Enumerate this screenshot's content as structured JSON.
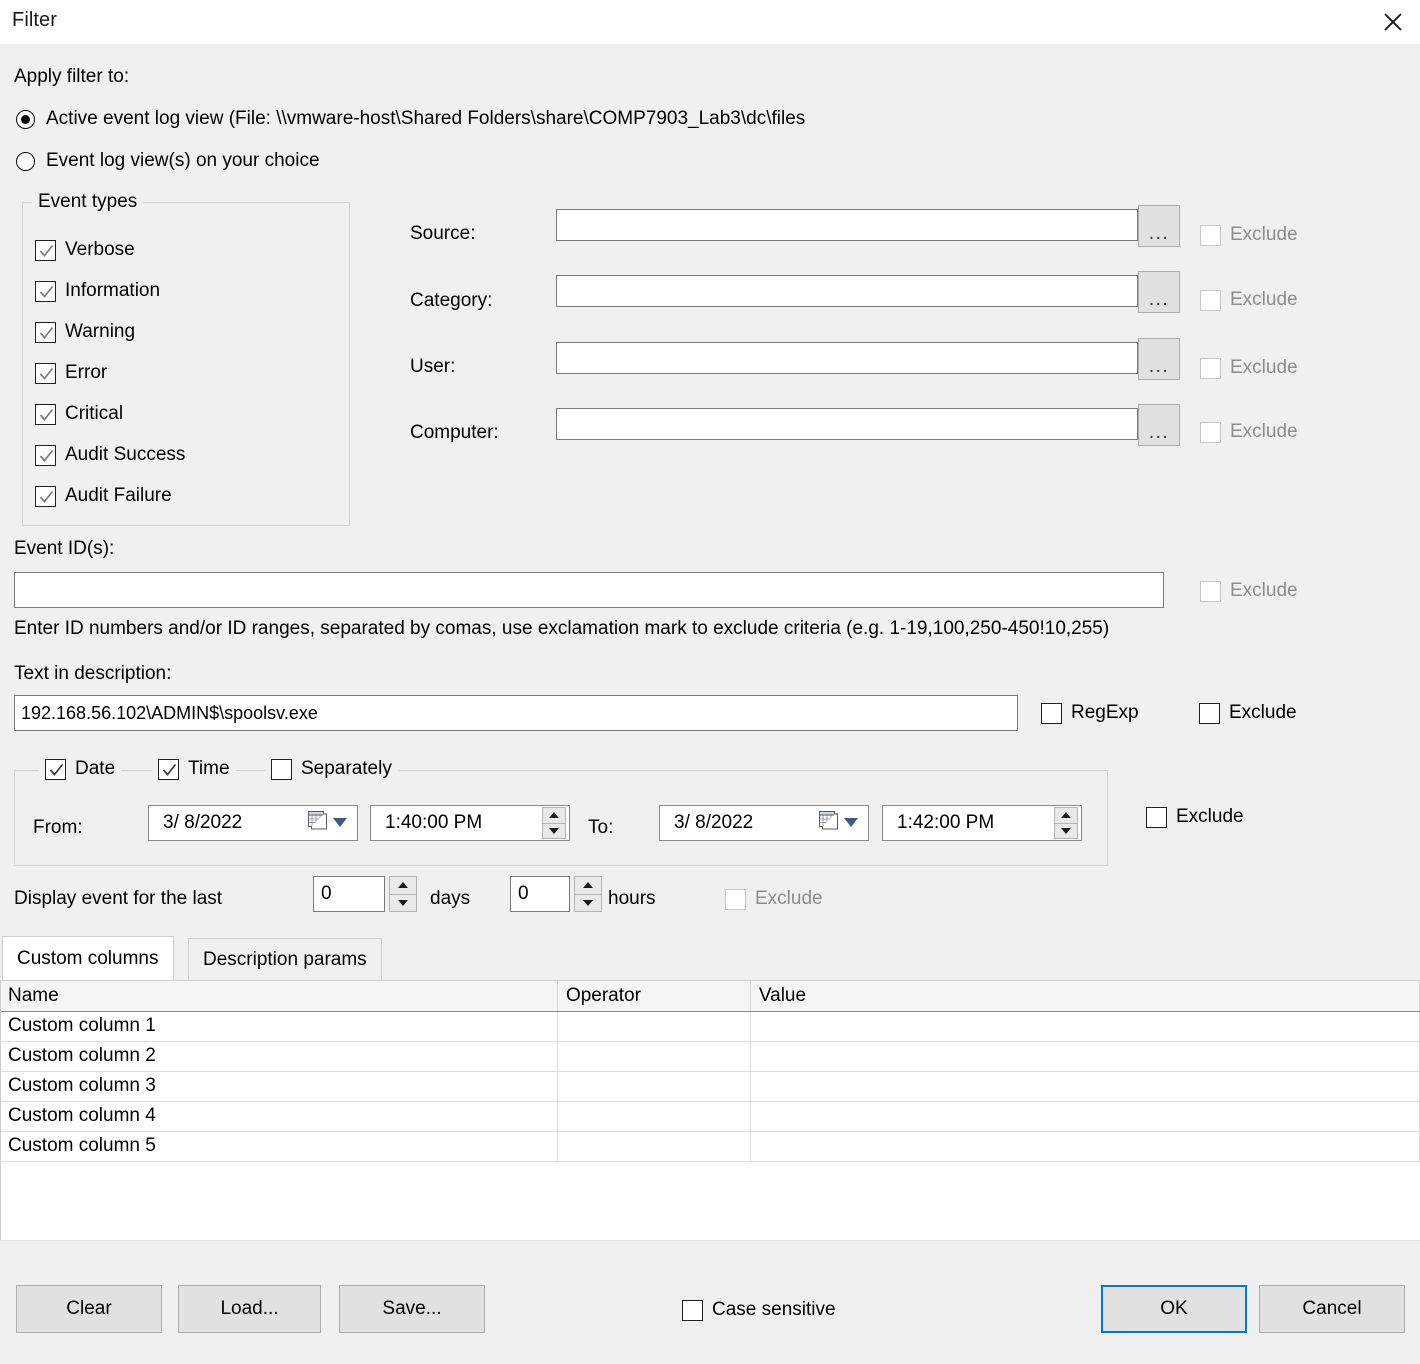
{
  "window": {
    "title": "Filter",
    "close_icon": "close-icon"
  },
  "apply_filter": {
    "label": "Apply filter to:",
    "options": [
      {
        "label": "Active event log view (File: \\\\vmware-host\\Shared Folders\\share\\COMP7903_Lab3\\dc\\files",
        "selected": true
      },
      {
        "label": "Event log view(s) on your choice",
        "selected": false
      }
    ]
  },
  "event_types": {
    "title": "Event types",
    "items": [
      {
        "label": "Verbose",
        "checked": true
      },
      {
        "label": "Information",
        "checked": true
      },
      {
        "label": "Warning",
        "checked": true
      },
      {
        "label": "Error",
        "checked": true
      },
      {
        "label": "Critical",
        "checked": true
      },
      {
        "label": "Audit Success",
        "checked": true
      },
      {
        "label": "Audit Failure",
        "checked": true
      }
    ]
  },
  "fields": {
    "browse_label": "...",
    "exclude_label": "Exclude",
    "rows": [
      {
        "label": "Source:",
        "value": "",
        "exclude_checked": false,
        "exclude_enabled": false
      },
      {
        "label": "Category:",
        "value": "",
        "exclude_checked": false,
        "exclude_enabled": false
      },
      {
        "label": "User:",
        "value": "",
        "exclude_checked": false,
        "exclude_enabled": false
      },
      {
        "label": "Computer:",
        "value": "",
        "exclude_checked": false,
        "exclude_enabled": false
      }
    ]
  },
  "event_ids": {
    "label": "Event ID(s):",
    "value": "",
    "exclude_label": "Exclude",
    "hint": "Enter ID numbers and/or ID ranges, separated by comas, use exclamation mark to exclude criteria (e.g. 1-19,100,250-450!10,255)"
  },
  "description_text": {
    "label": "Text in description:",
    "value": "192.168.56.102\\ADMIN$\\spoolsv.exe",
    "regexp_label": "RegExp",
    "regexp_checked": false,
    "exclude_label": "Exclude",
    "exclude_checked": false
  },
  "datetime": {
    "date_label": "Date",
    "date_checked": true,
    "time_label": "Time",
    "time_checked": true,
    "separately_label": "Separately",
    "separately_checked": false,
    "from_label": "From:",
    "from_date": "3/  8/2022",
    "from_time": "1:40:00 PM",
    "to_label": "To:",
    "to_date": "3/  8/2022",
    "to_time": "1:42:00 PM",
    "exclude_label": "Exclude",
    "exclude_checked": false
  },
  "display_last": {
    "label": "Display event for the last",
    "days_value": "0",
    "days_label": "days",
    "hours_value": "0",
    "hours_label": "hours",
    "exclude_label": "Exclude",
    "exclude_enabled": false
  },
  "tabs": [
    {
      "label": "Custom columns",
      "active": true
    },
    {
      "label": "Description params",
      "active": false
    }
  ],
  "table": {
    "headers": [
      "Name",
      "Operator",
      "Value"
    ],
    "rows": [
      [
        "Custom column 1",
        "",
        ""
      ],
      [
        "Custom column 2",
        "",
        ""
      ],
      [
        "Custom column 3",
        "",
        ""
      ],
      [
        "Custom column 4",
        "",
        ""
      ],
      [
        "Custom column 5",
        "",
        ""
      ]
    ]
  },
  "footer": {
    "clear_label": "Clear",
    "load_label": "Load...",
    "save_label": "Save...",
    "case_sensitive_label": "Case sensitive",
    "case_sensitive_checked": false,
    "ok_label": "OK",
    "cancel_label": "Cancel"
  },
  "colors": {
    "dialog_bg": "#f0f0f0",
    "focus_blue": "#0078d7",
    "disabled_text": "#8d8d8d"
  }
}
